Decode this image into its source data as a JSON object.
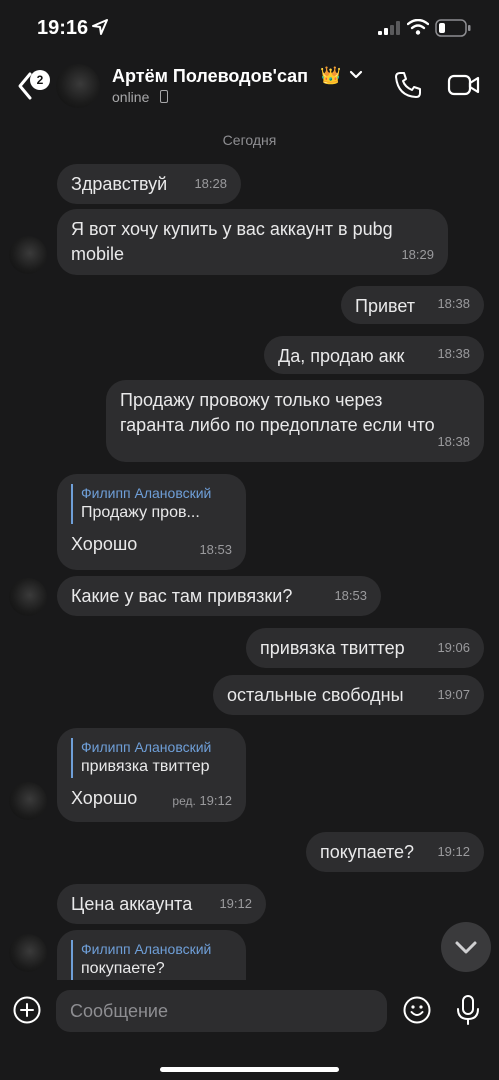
{
  "status_bar": {
    "time": "19:16"
  },
  "header": {
    "back_badge": "2",
    "contact_name": "Артём Полеводов'сап",
    "crown": "👑",
    "presence": "online"
  },
  "chat": {
    "date_separator": "Сегодня",
    "messages": [
      {
        "text": "Здравствуй",
        "time": "18:28"
      },
      {
        "text": "Я вот хочу купить у вас аккаунт в pubg\nmobile",
        "time": "18:29"
      },
      {
        "text": "Привет",
        "time": "18:38"
      },
      {
        "text": "Да, продаю акк",
        "time": "18:38"
      },
      {
        "text": "Продажу провожу только через\nгаранта либо по предоплате если что",
        "time": "18:38"
      },
      {
        "reply_author": "Филипп Алановский",
        "reply_text": "Продажу пров...",
        "text": "Хорошо",
        "time": "18:53"
      },
      {
        "text": "Какие у вас там привязки?",
        "time": "18:53"
      },
      {
        "text": "привязка твиттер",
        "time": "19:06"
      },
      {
        "text": "остальные свободны",
        "time": "19:07"
      },
      {
        "reply_author": "Филипп Алановский",
        "reply_text": "привязка твиттер",
        "text": "Хорошо",
        "edited": "ред.",
        "time": "19:12"
      },
      {
        "text": "покупаете?",
        "time": "19:12"
      },
      {
        "text": "Цена аккаунта",
        "time": "19:12"
      },
      {
        "reply_author": "Филипп Алановский",
        "reply_text": "покупаете?"
      }
    ]
  },
  "composer": {
    "placeholder": "Сообщение"
  },
  "colors": {
    "background": "#19191a",
    "bubble": "#2d2d2f",
    "reply_accent": "#6f9fd8"
  }
}
